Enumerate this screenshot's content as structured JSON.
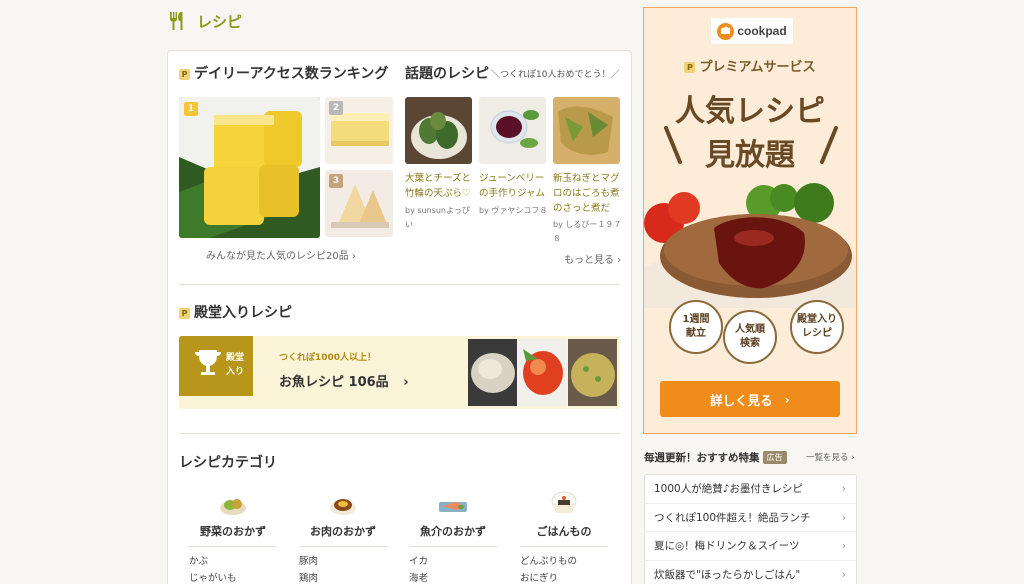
{
  "header": {
    "title": "レシピ",
    "icon": "fork-knife-icon"
  },
  "ranking": {
    "title": "デイリーアクセス数ランキング",
    "ranks": [
      "1",
      "2",
      "3"
    ],
    "more_link": "みんなが見た人気のレシピ20品 ›"
  },
  "topics": {
    "title": "話題のレシピ",
    "subtitle": "＼つくれぽ10人おめでとう！／",
    "items": [
      {
        "name": "大葉とチーズと竹輪の天ぷら♡",
        "author": "by sunsunよっぴい"
      },
      {
        "name": "ジューンベリーの手作りジャム",
        "author": "by ヴァヤシコフ８"
      },
      {
        "name": "新玉ねぎとマグロのはごろも煮のさっと煮だ",
        "author": "by しるびー１９７８"
      }
    ],
    "more_link": "もっと見る ›"
  },
  "hall": {
    "title": "殿堂入りレシピ",
    "flag_line1": "殿堂",
    "flag_line2": "入り",
    "subtitle": "つくれぽ1000人以上！",
    "main_text": "お魚レシピ 106品",
    "arrow": "›"
  },
  "categories": {
    "title": "レシピカテゴリ",
    "items": [
      {
        "name": "野菜のおかず",
        "subs": [
          "かぶ",
          "じゃがいも"
        ]
      },
      {
        "name": "お肉のおかず",
        "subs": [
          "豚肉",
          "鶏肉"
        ]
      },
      {
        "name": "魚介のおかず",
        "subs": [
          "イカ",
          "海老"
        ]
      },
      {
        "name": "ごはんもの",
        "subs": [
          "どんぶりもの",
          "おにぎり"
        ]
      }
    ]
  },
  "ad": {
    "logo_text": "cookpad",
    "premium": "プレミアムサービス",
    "headline1": "人気レシピ",
    "headline2": "見放題",
    "features": [
      "1週間\n献立",
      "人気順\n検索",
      "殿堂入り\nレシピ"
    ],
    "button": "詳しく見る",
    "button_arrow": "›"
  },
  "weekly": {
    "title": "毎週更新！おすすめ特集",
    "ad_tag": "広告",
    "more": "一覧を見る ›",
    "items": [
      "1000人が絶賛♪お墨付きレシピ",
      "つくれぽ100件超え！絶品ランチ",
      "夏に◎！梅ドリンク＆スイーツ",
      "炊飯器で\"ほったらかしごはん\""
    ]
  },
  "colors": {
    "accent": "#8a9a1e",
    "orange": "#f08c1a",
    "gold": "#b8961a"
  }
}
